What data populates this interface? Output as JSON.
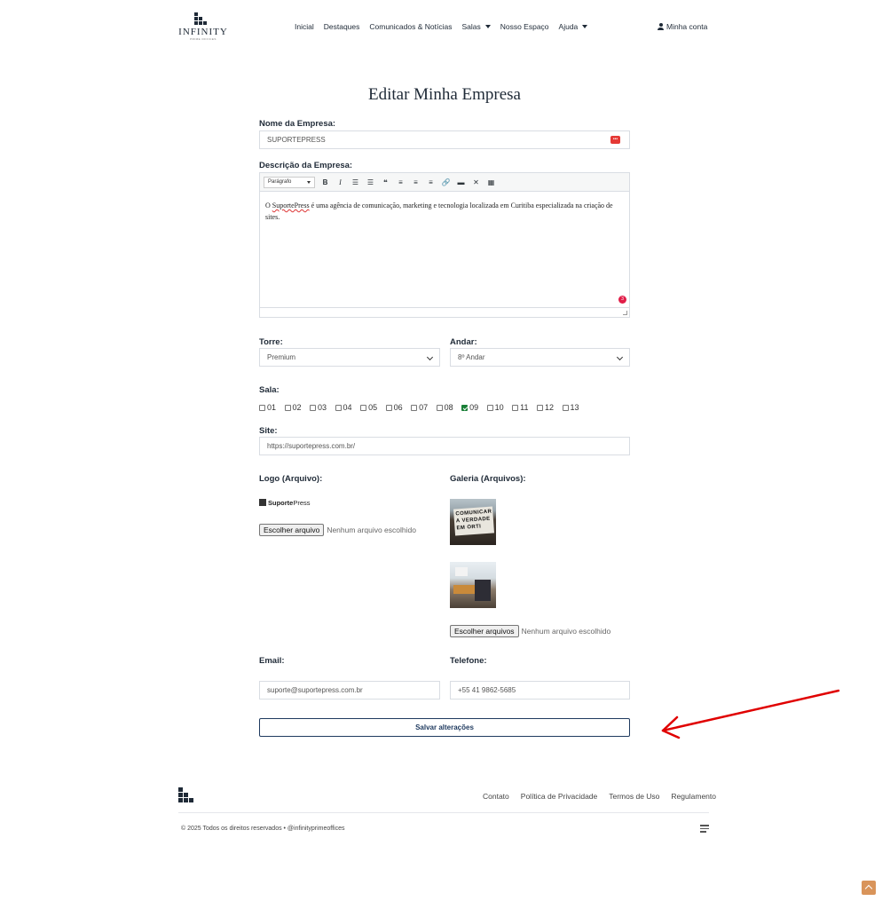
{
  "header": {
    "brand": "INFINITY",
    "brand_tagline": "PRIME OFFICES",
    "nav": [
      "Inicial",
      "Destaques",
      "Comunicados & Notícias",
      "Salas",
      "Nosso Espaço",
      "Ajuda"
    ],
    "account": "Minha conta"
  },
  "page_title": "Editar Minha Empresa",
  "form": {
    "company_name_label": "Nome da Empresa:",
    "company_name_value": "SUPORTEPRESS",
    "description_label": "Descrição da Empresa:",
    "editor_format": "Parágrafo",
    "description_pre": "O ",
    "description_link": "SuportePress",
    "description_post": " é uma agência de comunicação, marketing e tecnologia localizada em Curitiba especializada na criação de sites.",
    "editor_badge": "3",
    "tower_label": "Torre:",
    "tower_value": "Premium",
    "floor_label": "Andar:",
    "floor_value": "8º Andar",
    "room_label": "Sala:",
    "rooms": [
      "01",
      "02",
      "03",
      "04",
      "05",
      "06",
      "07",
      "08",
      "09",
      "10",
      "11",
      "12",
      "13"
    ],
    "room_checked": "09",
    "site_label": "Site:",
    "site_value": "https://suportepress.com.br/",
    "logo_label": "Logo (Arquivo):",
    "logo_brand_bold": "Suporte",
    "logo_brand_light": "Press",
    "gallery_label": "Galeria (Arquivos):",
    "gallery_sign_text": "COMUNICAR A VERDADE EM ORTI",
    "choose_file": "Escolher arquivo",
    "choose_files": "Escolher arquivos",
    "no_file": "Nenhum arquivo escolhido",
    "email_label": "Email:",
    "email_value": "suporte@suportepress.com.br",
    "phone_label": "Telefone:",
    "phone_value": "+55 41 9862-5685",
    "save_button": "Salvar alterações"
  },
  "footer": {
    "links": [
      "Contato",
      "Política de Privacidade",
      "Termos de Uso",
      "Regulamento"
    ],
    "copyright": "© 2025 Todos os direitos reservados • @infinityprimeoffices"
  },
  "colors": {
    "primary": "#1f3a5f",
    "checkbox_checked": "#1a7f37",
    "arrow_annotation": "#e00000",
    "back_to_top": "#d9945a"
  },
  "icons": [
    "user-icon",
    "password-manager-icon",
    "chevron-down-icon",
    "menu-icon",
    "arrow-up-icon"
  ]
}
